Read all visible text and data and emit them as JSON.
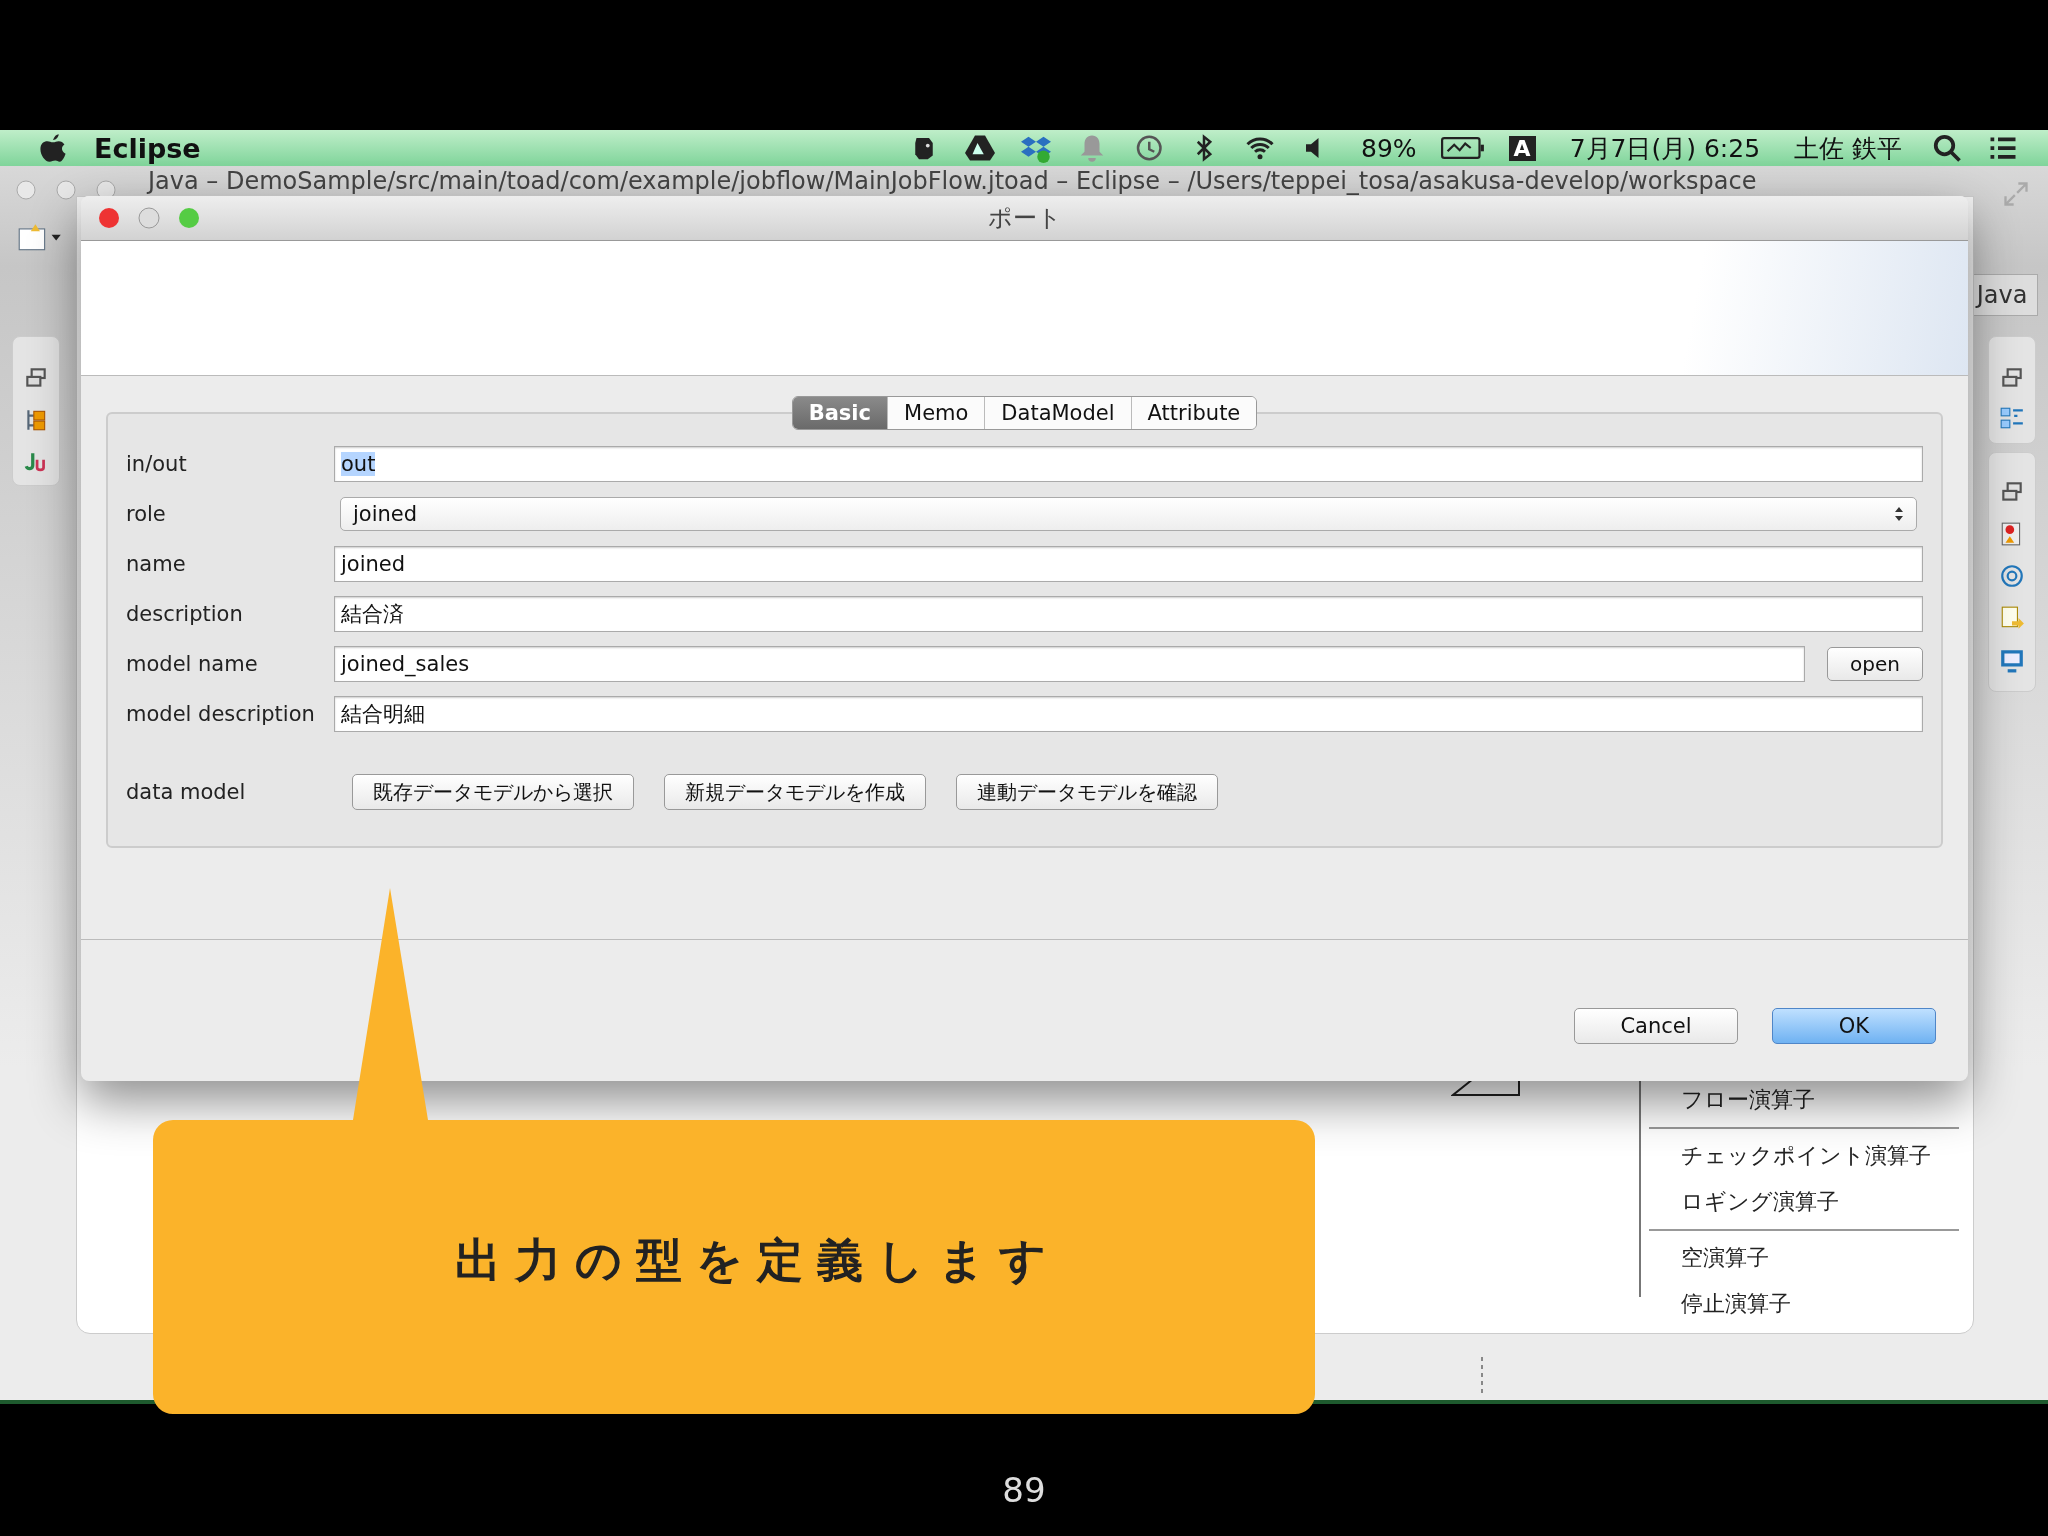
{
  "menu_bar": {
    "app_name": "Eclipse",
    "battery": "89%",
    "input_mode": "A",
    "datetime": "7月7日(月) 6:25",
    "user": "土佐 鉄平"
  },
  "ide_window": {
    "title": "Java – DemoSample/src/main/toad/com/example/jobflow/MainJobFlow.jtoad – Eclipse – /Users/teppei_tosa/asakusa-develop/workspace",
    "perspective": "Java",
    "palette_groups": [
      {
        "items": [
          "フロー演算子"
        ]
      },
      {
        "items": [
          "チェックポイント演算子",
          "ロギング演算子"
        ]
      },
      {
        "items": [
          "空演算子",
          "停止演算子"
        ]
      }
    ]
  },
  "dialog": {
    "title": "ポート",
    "tabs": [
      {
        "label": "Basic",
        "selected": true
      },
      {
        "label": "Memo",
        "selected": false
      },
      {
        "label": "DataModel",
        "selected": false
      },
      {
        "label": "Attribute",
        "selected": false
      }
    ],
    "fields": [
      {
        "label": "in/out",
        "kind": "text",
        "value": "out",
        "highlighted": true
      },
      {
        "label": "role",
        "kind": "select",
        "value": "joined",
        "highlighted": false
      },
      {
        "label": "name",
        "kind": "text",
        "value": "joined",
        "highlighted": false
      },
      {
        "label": "description",
        "kind": "text",
        "value": "結合済",
        "highlighted": false
      },
      {
        "label": "model name",
        "kind": "text_button",
        "value": "joined_sales",
        "button": "open",
        "highlighted": false
      },
      {
        "label": "model description",
        "kind": "text",
        "value": "結合明細",
        "highlighted": false
      }
    ],
    "data_model": {
      "label": "data model",
      "buttons": [
        "既存データモデルから選択",
        "新規データモデルを作成",
        "連動データモデルを確認"
      ]
    },
    "buttons": [
      {
        "label": "Cancel",
        "default": false
      },
      {
        "label": "OK",
        "default": true
      }
    ]
  },
  "callout": {
    "text": "出力の型を定義します"
  },
  "page_number": "89"
}
